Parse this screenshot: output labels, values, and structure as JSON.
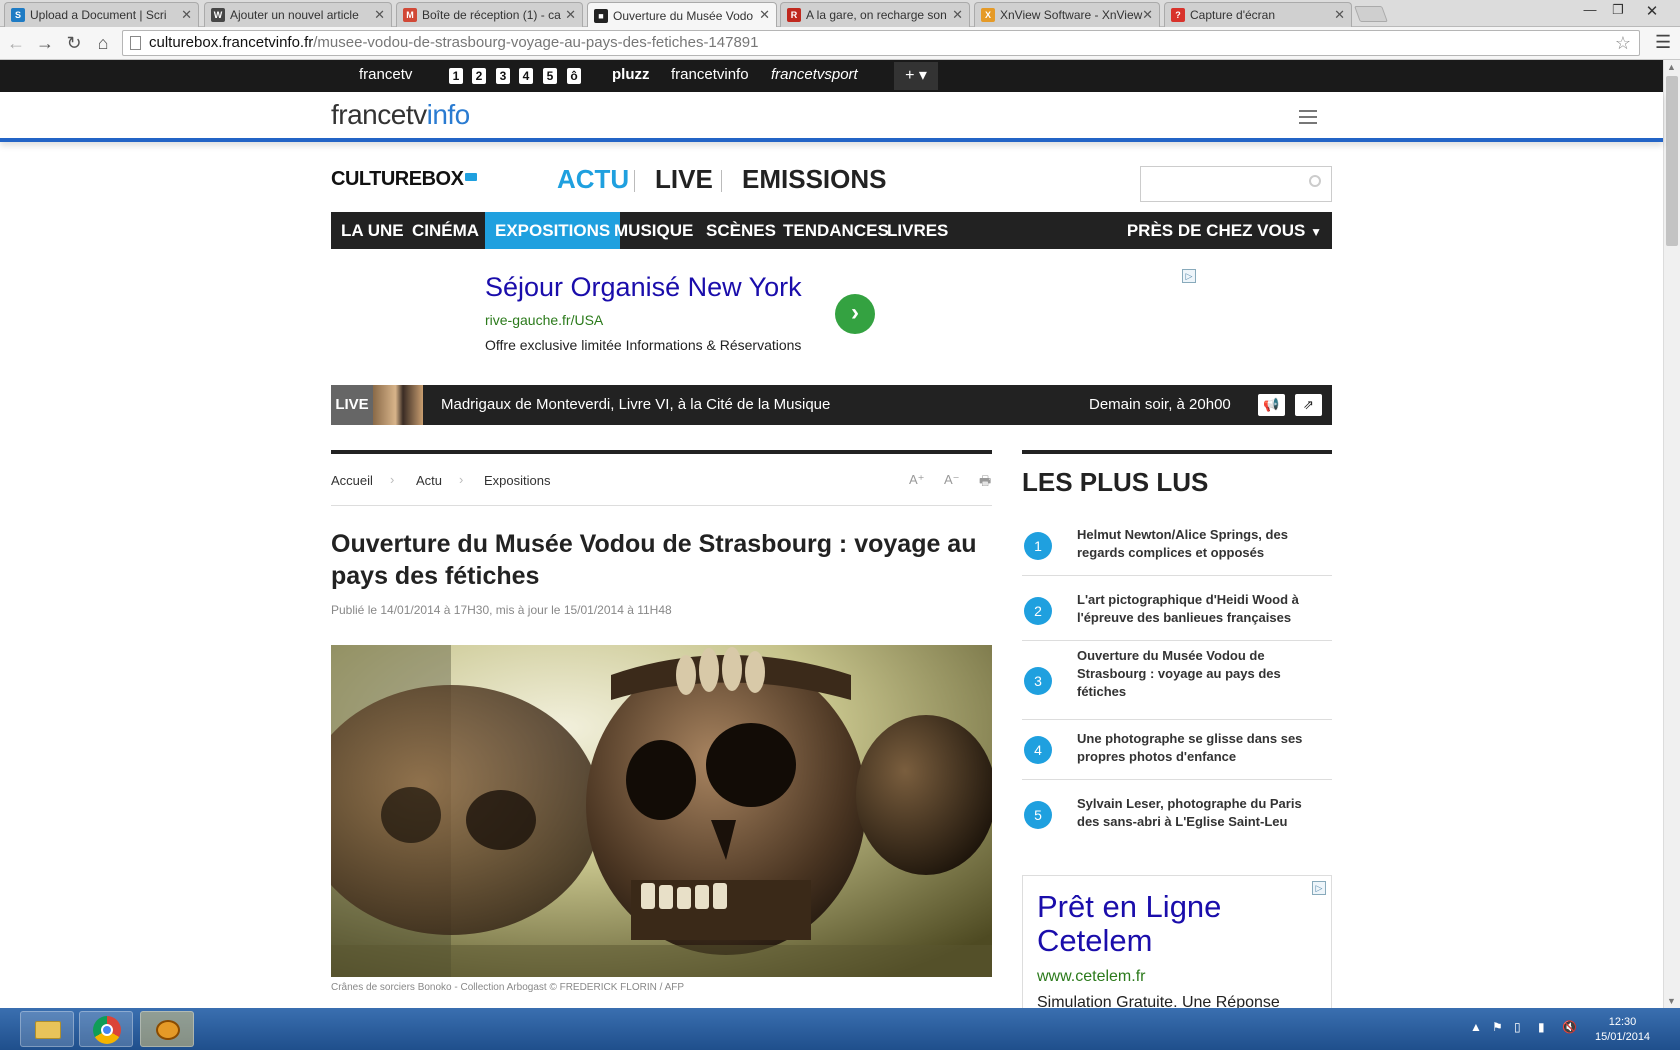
{
  "browser": {
    "tabs": [
      {
        "label": "Upload a Document | Scri",
        "icon": "scribd-icon",
        "color": "#1e7bc4",
        "glyph": "S"
      },
      {
        "label": "Ajouter un nouvel article",
        "icon": "wordpress-icon",
        "color": "#464646",
        "glyph": "W"
      },
      {
        "label": "Boîte de réception (1) - ca",
        "icon": "gmail-icon",
        "color": "#d14836",
        "glyph": "M"
      },
      {
        "label": "Ouverture du Musée Vodo",
        "icon": "culturebox-icon",
        "color": "#222222",
        "glyph": "■"
      },
      {
        "label": "A la gare, on recharge son",
        "icon": "rue89-icon",
        "color": "#c0281e",
        "glyph": "R"
      },
      {
        "label": "XnView Software - XnView",
        "icon": "xnview-icon",
        "color": "#e59a27",
        "glyph": "X"
      },
      {
        "label": "Capture d'écran",
        "icon": "help-icon",
        "color": "#d8322b",
        "glyph": "?"
      }
    ],
    "active_tab": 3,
    "url_host": "culturebox.francetvinfo.fr",
    "url_path": "/musee-vodou-de-strasbourg-voyage-au-pays-des-fetiches-147891"
  },
  "ftv_bar": {
    "brand": "francetv",
    "channels": [
      "1",
      "2",
      "3",
      "4",
      "5",
      "ô"
    ],
    "links": [
      "pluzz",
      "francetvinfo",
      "francetvsport"
    ],
    "plus": "+ ▾"
  },
  "header": {
    "logo_main": "francetv",
    "logo_accent": "info"
  },
  "culturebox": {
    "logo": "CULTUREBOX",
    "nav": [
      {
        "label": "ACTU",
        "color": "#1fa0df"
      },
      {
        "label": "LIVE",
        "color": "#222222"
      },
      {
        "label": "EMISSIONS",
        "color": "#222222"
      }
    ],
    "search_placeholder": ""
  },
  "categories": [
    "LA UNE",
    "CINÉMA",
    "EXPOSITIONS",
    "MUSIQUE",
    "SCÈNES",
    "TENDANCES",
    "LIVRES"
  ],
  "active_category": 2,
  "pres_label": "PRÈS DE CHEZ VOUS",
  "ad_top": {
    "title": "Séjour Organisé New York",
    "url": "rive-gauche.fr/USA",
    "desc": "Offre exclusive limitée Informations & Réservations",
    "go": "›"
  },
  "live": {
    "label": "LIVE",
    "title": "Madrigaux de Monteverdi, Livre VI, à la Cité de la Musique",
    "time": "Demain soir, à 20h00"
  },
  "breadcrumb": [
    "Accueil",
    "Actu",
    "Expositions"
  ],
  "article_tools": {
    "font_up": "A⁺",
    "font_down": "A⁻",
    "print": "🖶"
  },
  "article": {
    "title": "Ouverture du Musée Vodou de Strasbourg : voyage au pays des fétiches",
    "date": "Publié le 14/01/2014 à 17H30, mis à jour le 15/01/2014 à 11H48",
    "caption": "Crânes de sorciers Bonoko - Collection Arbogast   © FREDERICK FLORIN / AFP"
  },
  "most_read": {
    "title": "LES PLUS LUS",
    "items": [
      {
        "num": "1",
        "text": "Helmut Newton/Alice Springs, des regards complices et opposés"
      },
      {
        "num": "2",
        "text": "L'art pictographique d'Heidi Wood à l'épreuve des banlieues françaises"
      },
      {
        "num": "3",
        "text": "Ouverture du Musée Vodou de Strasbourg : voyage au pays des fétiches"
      },
      {
        "num": "4",
        "text": "Une photographe se glisse dans ses propres photos d'enfance"
      },
      {
        "num": "5",
        "text": "Sylvain Leser, photographe du Paris des sans-abri à L'Eglise Saint-Leu"
      }
    ]
  },
  "ad_side": {
    "title": "Prêt en Ligne Cetelem",
    "url": "www.cetelem.fr",
    "desc": "Simulation Gratuite. Une Réponse"
  },
  "taskbar": {
    "apps": [
      "file-explorer-icon",
      "chrome-icon",
      "xnview-icon"
    ],
    "time": "12:30",
    "date": "15/01/2014"
  }
}
